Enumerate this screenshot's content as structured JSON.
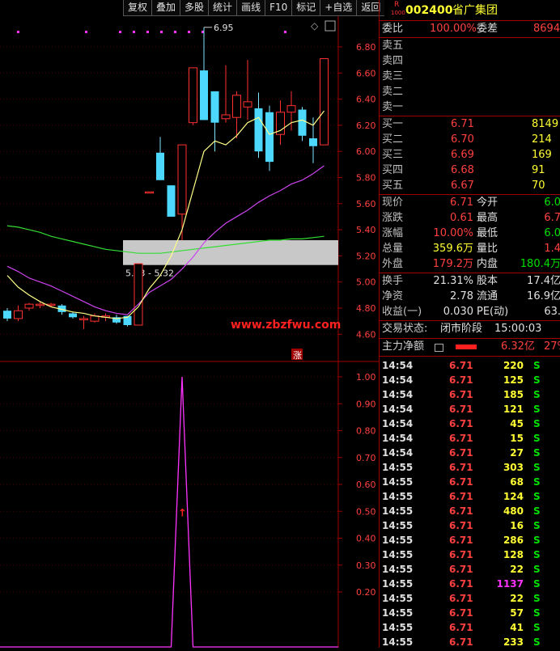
{
  "toolbar": [
    "复权",
    "叠加",
    "多股",
    "统计",
    "画线",
    "F10",
    "标记",
    "+自选",
    "返回"
  ],
  "stock": {
    "code": "002400",
    "name": "省广集团",
    "badge_top": "R",
    "badge_bottom": "1000"
  },
  "commission": {
    "ratio_label": "委比",
    "ratio": "100.00%",
    "diff_label": "委差",
    "diff": "8694"
  },
  "asks": [
    {
      "label": "卖五",
      "price": "",
      "vol": ""
    },
    {
      "label": "卖四",
      "price": "",
      "vol": ""
    },
    {
      "label": "卖三",
      "price": "",
      "vol": ""
    },
    {
      "label": "卖二",
      "price": "",
      "vol": ""
    },
    {
      "label": "卖一",
      "price": "",
      "vol": ""
    }
  ],
  "bids": [
    {
      "label": "买一",
      "price": "6.71",
      "vol": "8149"
    },
    {
      "label": "买二",
      "price": "6.70",
      "vol": "214"
    },
    {
      "label": "买三",
      "price": "6.69",
      "vol": "169"
    },
    {
      "label": "买四",
      "price": "6.68",
      "vol": "91"
    },
    {
      "label": "买五",
      "price": "6.67",
      "vol": "70"
    }
  ],
  "quote": [
    {
      "l1": "现价",
      "v1": "6.71",
      "c1": "red",
      "l2": "今开",
      "v2": "6.0",
      "c2": "grn"
    },
    {
      "l1": "涨跌",
      "v1": "0.61",
      "c1": "red",
      "l2": "最高",
      "v2": "6.7",
      "c2": "red"
    },
    {
      "l1": "涨幅",
      "v1": "10.00%",
      "c1": "red",
      "l2": "最低",
      "v2": "6.0",
      "c2": "grn"
    },
    {
      "l1": "总量",
      "v1": "359.6万",
      "c1": "yel",
      "l2": "量比",
      "v2": "1.4",
      "c2": "red"
    },
    {
      "l1": "外盘",
      "v1": "179.2万",
      "c1": "red",
      "l2": "内盘",
      "v2": "180.4万",
      "c2": "grn"
    }
  ],
  "finance": [
    {
      "l1": "换手",
      "v1": "21.31%",
      "l2": "股本",
      "v2": "17.4亿"
    },
    {
      "l1": "净资",
      "v1": "2.78",
      "l2": "流通",
      "v2": "16.9亿"
    },
    {
      "l1": "收益(一)",
      "v1": "0.030",
      "l2": "PE(动)",
      "v2": "63."
    }
  ],
  "trade_status": {
    "label": "交易状态:",
    "value": "闭市阶段",
    "time": "15:00:03"
  },
  "main_flow": {
    "label": "主力净额",
    "value": "6.32亿",
    "extra": "27%"
  },
  "ticks": [
    {
      "t": "14:54",
      "p": "6.71",
      "v": "220",
      "s": "S"
    },
    {
      "t": "14:54",
      "p": "6.71",
      "v": "125",
      "s": "S"
    },
    {
      "t": "14:54",
      "p": "6.71",
      "v": "185",
      "s": "S"
    },
    {
      "t": "14:54",
      "p": "6.71",
      "v": "121",
      "s": "S"
    },
    {
      "t": "14:54",
      "p": "6.71",
      "v": "45",
      "s": "S"
    },
    {
      "t": "14:54",
      "p": "6.71",
      "v": "15",
      "s": "S"
    },
    {
      "t": "14:54",
      "p": "6.71",
      "v": "27",
      "s": "S"
    },
    {
      "t": "14:55",
      "p": "6.71",
      "v": "303",
      "s": "S"
    },
    {
      "t": "14:55",
      "p": "6.71",
      "v": "68",
      "s": "S"
    },
    {
      "t": "14:55",
      "p": "6.71",
      "v": "124",
      "s": "S"
    },
    {
      "t": "14:55",
      "p": "6.71",
      "v": "480",
      "s": "S"
    },
    {
      "t": "14:55",
      "p": "6.71",
      "v": "16",
      "s": "S"
    },
    {
      "t": "14:55",
      "p": "6.71",
      "v": "286",
      "s": "S"
    },
    {
      "t": "14:55",
      "p": "6.71",
      "v": "128",
      "s": "S"
    },
    {
      "t": "14:55",
      "p": "6.71",
      "v": "22",
      "s": "S"
    },
    {
      "t": "14:55",
      "p": "6.71",
      "v": "1137",
      "s": "S"
    },
    {
      "t": "14:55",
      "p": "6.71",
      "v": "22",
      "s": "S"
    },
    {
      "t": "14:55",
      "p": "6.71",
      "v": "57",
      "s": "S"
    },
    {
      "t": "14:55",
      "p": "6.71",
      "v": "41",
      "s": "S"
    },
    {
      "t": "14:55",
      "p": "6.71",
      "v": "233",
      "s": "S"
    }
  ],
  "chart_data": {
    "type": "candlestick",
    "price_axis": [
      "6.80",
      "6.60",
      "6.40",
      "6.20",
      "6.00",
      "5.80",
      "5.60",
      "5.40",
      "5.20",
      "5.00",
      "4.80",
      "4.60"
    ],
    "indicator_axis": [
      "1.00",
      "0.90",
      "0.80",
      "0.70",
      "0.60",
      "0.50",
      "0.40",
      "0.30",
      "0.20"
    ],
    "annotations": {
      "high_label": "6.95",
      "band_label": "5.13 - 5.32",
      "limit_up_mark": "涨",
      "watermark": "www.zbzfwu.com"
    },
    "candles": [
      {
        "o": 4.78,
        "c": 4.72,
        "h": 4.8,
        "l": 4.7
      },
      {
        "o": 4.72,
        "c": 4.78,
        "h": 4.82,
        "l": 4.7
      },
      {
        "o": 4.8,
        "c": 4.83,
        "h": 4.84,
        "l": 4.78
      },
      {
        "o": 4.82,
        "c": 4.83,
        "h": 4.85,
        "l": 4.8
      },
      {
        "o": 4.83,
        "c": 4.83,
        "h": 4.84,
        "l": 4.81
      },
      {
        "o": 4.82,
        "c": 4.77,
        "h": 4.83,
        "l": 4.75
      },
      {
        "o": 4.76,
        "c": 4.73,
        "h": 4.77,
        "l": 4.72
      },
      {
        "o": 4.72,
        "c": 4.72,
        "h": 4.74,
        "l": 4.64
      },
      {
        "o": 4.7,
        "c": 4.74,
        "h": 4.76,
        "l": 4.69
      },
      {
        "o": 4.73,
        "c": 4.74,
        "h": 4.76,
        "l": 4.7
      },
      {
        "o": 4.73,
        "c": 4.69,
        "h": 4.75,
        "l": 4.68
      },
      {
        "o": 4.74,
        "c": 4.67,
        "h": 4.74,
        "l": 4.66
      },
      {
        "o": 4.67,
        "c": 5.14,
        "h": 5.14,
        "l": 4.67
      },
      {
        "o": 5.69,
        "c": 5.69,
        "h": 5.69,
        "l": 5.69
      },
      {
        "o": 5.99,
        "c": 5.78,
        "h": 6.11,
        "l": 5.78
      },
      {
        "o": 5.74,
        "c": 5.5,
        "h": 5.74,
        "l": 5.5
      },
      {
        "o": 5.52,
        "c": 6.05,
        "h": 6.05,
        "l": 5.32
      },
      {
        "o": 6.22,
        "c": 6.64,
        "h": 6.64,
        "l": 6.2
      },
      {
        "o": 6.62,
        "c": 6.24,
        "h": 6.95,
        "l": 6.24
      },
      {
        "o": 6.46,
        "c": 6.22,
        "h": 6.46,
        "l": 6.0
      },
      {
        "o": 6.25,
        "c": 6.28,
        "h": 6.66,
        "l": 6.22
      },
      {
        "o": 6.26,
        "c": 6.43,
        "h": 6.46,
        "l": 6.1
      },
      {
        "o": 6.34,
        "c": 6.38,
        "h": 6.7,
        "l": 6.24
      },
      {
        "o": 6.33,
        "c": 6.0,
        "h": 6.45,
        "l": 5.95
      },
      {
        "o": 6.3,
        "c": 5.92,
        "h": 6.35,
        "l": 5.85
      },
      {
        "o": 6.13,
        "c": 6.3,
        "h": 6.39,
        "l": 6.05
      },
      {
        "o": 6.3,
        "c": 6.35,
        "h": 6.46,
        "l": 6.16
      },
      {
        "o": 6.32,
        "c": 6.12,
        "h": 6.34,
        "l": 6.08
      },
      {
        "o": 6.1,
        "c": 6.04,
        "h": 6.26,
        "l": 5.91
      },
      {
        "o": 6.05,
        "c": 6.71,
        "h": 6.71,
        "l": 6.05
      }
    ],
    "ma_yellow": [
      5.05,
      4.96,
      4.9,
      4.85,
      4.81,
      4.79,
      4.77,
      4.76,
      4.74,
      4.73,
      4.72,
      4.73,
      4.81,
      4.95,
      5.05,
      5.2,
      5.4,
      5.7,
      6.0,
      6.08,
      6.05,
      6.12,
      6.22,
      6.26,
      6.13,
      6.16,
      6.22,
      6.24,
      6.2,
      6.31
    ],
    "ma_magenta": [
      5.12,
      5.08,
      5.03,
      5.0,
      4.97,
      4.93,
      4.89,
      4.85,
      4.81,
      4.78,
      4.76,
      4.75,
      4.83,
      4.92,
      4.97,
      5.02,
      5.1,
      5.19,
      5.3,
      5.38,
      5.45,
      5.5,
      5.55,
      5.61,
      5.66,
      5.7,
      5.75,
      5.78,
      5.83,
      5.89
    ],
    "ma_green": [
      5.43,
      5.42,
      5.4,
      5.38,
      5.35,
      5.33,
      5.31,
      5.29,
      5.27,
      5.25,
      5.24,
      5.23,
      5.22,
      5.22,
      5.22,
      5.23,
      5.24,
      5.25,
      5.26,
      5.27,
      5.28,
      5.29,
      5.3,
      5.31,
      5.32,
      5.32,
      5.33,
      5.33,
      5.34,
      5.35
    ],
    "indicator": [
      0,
      0,
      0,
      0,
      0,
      0,
      0,
      0,
      0,
      0,
      0,
      0,
      0,
      0,
      0,
      0,
      1.0,
      0,
      0,
      0,
      0,
      0,
      0,
      0,
      0,
      0,
      0,
      0,
      0,
      0
    ]
  }
}
